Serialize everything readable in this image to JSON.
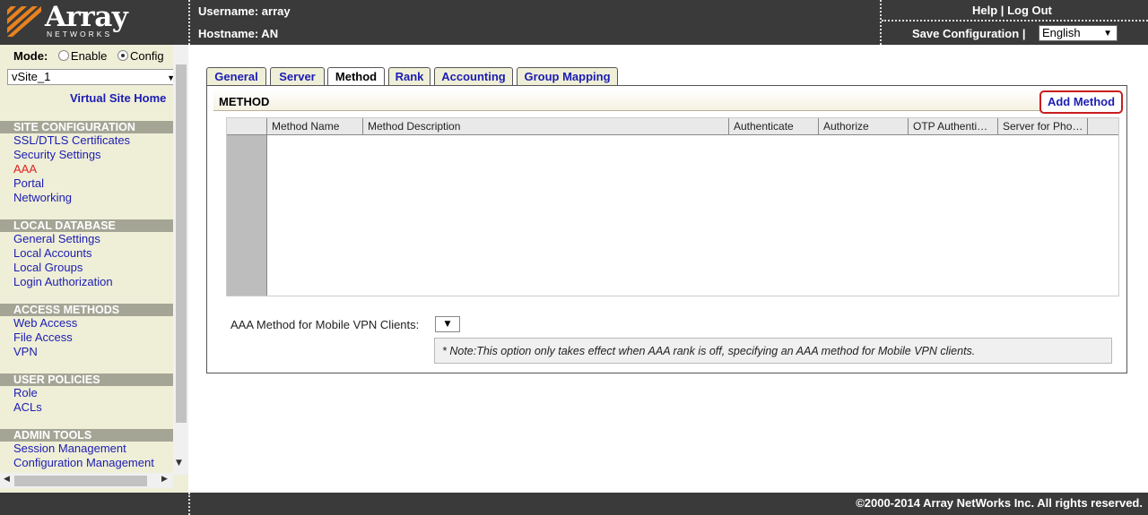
{
  "header": {
    "logo_text": "Array",
    "logo_subtext": "NETWORKS",
    "username_label": "Username: array",
    "hostname_label": "Hostname: AN",
    "help_label": "Help",
    "separator": "|",
    "logout_label": "Log Out",
    "save_config_label": "Save Configuration",
    "language": "English"
  },
  "sidebar": {
    "mode_label": "Mode:",
    "mode_options": [
      "Enable",
      "Config"
    ],
    "mode_selected": "Config",
    "site_select": "vSite_1",
    "virtual_site_home": "Virtual Site Home",
    "sections": [
      {
        "title": "SITE CONFIGURATION",
        "items": [
          "SSL/DTLS Certificates",
          "Security Settings",
          "AAA",
          "Portal",
          "Networking"
        ]
      },
      {
        "title": "LOCAL DATABASE",
        "items": [
          "General Settings",
          "Local Accounts",
          "Local Groups",
          "Login Authorization"
        ]
      },
      {
        "title": "ACCESS METHODS",
        "items": [
          "Web Access",
          "File Access",
          "VPN"
        ]
      },
      {
        "title": "USER POLICIES",
        "items": [
          "Role",
          "ACLs"
        ]
      },
      {
        "title": "ADMIN TOOLS",
        "items": [
          "Session Management",
          "Configuration Management"
        ]
      }
    ],
    "active_item": "AAA"
  },
  "tabs": [
    "General",
    "Server",
    "Method",
    "Rank",
    "Accounting",
    "Group Mapping"
  ],
  "active_tab": "Method",
  "panel": {
    "title": "METHOD",
    "add_button": "Add Method",
    "columns": [
      "Method Name",
      "Method Description",
      "Authenticate",
      "Authorize",
      "OTP Authenti…",
      "Server for Pho…"
    ],
    "rows": [],
    "mobile_label": "AAA Method for Mobile VPN Clients:",
    "mobile_value": "",
    "note": "* Note:This option only takes effect when AAA rank is off, specifying an AAA method for Mobile VPN clients."
  },
  "footer": {
    "copyright": "©2000-2014 Array NetWorks Inc. All rights reserved."
  },
  "colors": {
    "header_bg": "#3a3a3a",
    "sidebar_bg": "#efefd8",
    "section_bg": "#a5a596",
    "link": "#1c1cb2",
    "active_link": "#e02020",
    "highlight_border": "#c81e1e"
  }
}
